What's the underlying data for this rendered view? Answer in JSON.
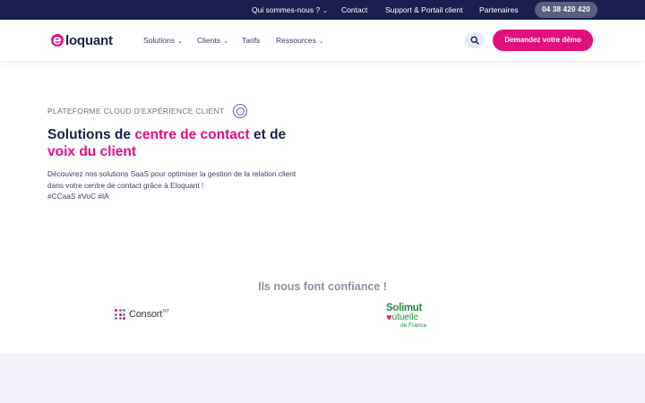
{
  "topbar": {
    "items": [
      {
        "label": "Qui sommes-nous ?",
        "has_dropdown": true
      },
      {
        "label": "Contact"
      },
      {
        "label": "Support & Portail client"
      },
      {
        "label": "Partenaires"
      }
    ],
    "phone": "04 38 420 420"
  },
  "nav": {
    "logo_text": "loquant",
    "items": [
      {
        "label": "Solutions",
        "has_dropdown": true
      },
      {
        "label": "Clients",
        "has_dropdown": true
      },
      {
        "label": "Tarifs",
        "has_dropdown": false
      },
      {
        "label": "Ressources",
        "has_dropdown": true
      }
    ],
    "search_icon": "search-icon",
    "cta_label": "Demandez votre démo"
  },
  "hero": {
    "eyebrow": "PLATEFORME CLOUD D'EXPÉRIENCE CLIENT",
    "title_part1": "Solutions de ",
    "title_highlight1": "centre de contact",
    "title_part2": " et de ",
    "title_highlight2": "voix du client",
    "description_lines": [
      "Découvrez nos solutions SaaS pour optimiser la gestion de la relation client",
      "dans votre centre de contact grâce à Eloquant !",
      "#CCaaS #VoC #IA"
    ]
  },
  "trust": {
    "title": "Ils nous font confiance !",
    "logos": [
      {
        "name": "Consort",
        "sup": "NT"
      },
      {
        "name_line1": "Solimut",
        "name_line2": "utuelle",
        "name_line3": "de France"
      }
    ]
  },
  "colors": {
    "navy": "#1b1f4f",
    "pink": "#e0117f",
    "muted": "#8e91a3",
    "band": "#f3f4fb"
  }
}
